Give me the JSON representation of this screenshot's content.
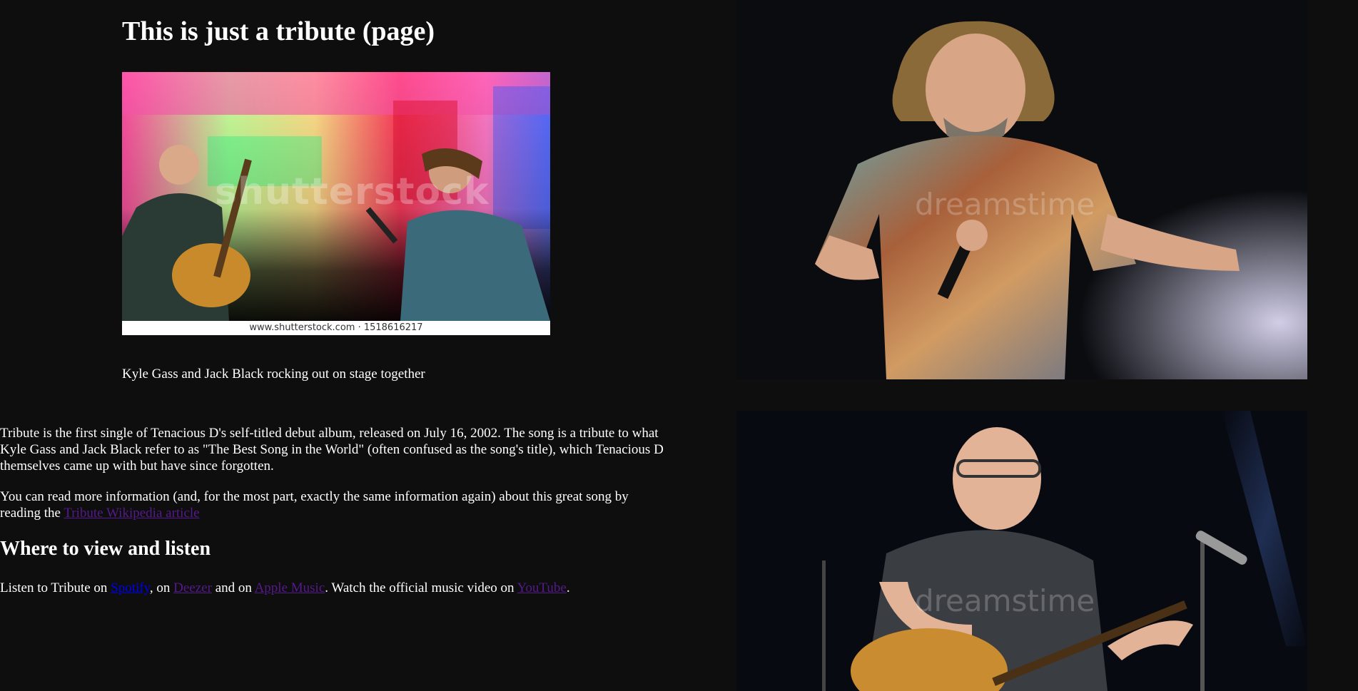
{
  "page": {
    "title": "This is just a tribute (page)"
  },
  "hero_image": {
    "alt": "Kyle Gass and Jack Black rocking out on stage together",
    "watermark": "shutterstock",
    "credit": "www.shutterstock.com · 1518616217"
  },
  "figure_caption": "Kyle Gass and Jack Black rocking out on stage together",
  "intro_paragraph": "Tribute is the first single of Tenacious D's self-titled debut album, released on July 16, 2002. The song is a tribute to what Kyle Gass and Jack Black refer to as \"The Best Song in the World\" (often confused as the song's title), which Tenacious D themselves came up with but have since forgotten.",
  "more_info": {
    "text_before": "You can read more information (and, for the most part, exactly the same information again) about this great song by reading the ",
    "link_label": "Tribute Wikipedia article"
  },
  "listen_section": {
    "heading": "Where to view and listen",
    "prefix": "Listen to Tribute on ",
    "spotify_label": "Spotify",
    "sep1": ", on ",
    "deezer_label": "Deezer",
    "sep2": " and on ",
    "apple_label": "Apple Music",
    "mid": ". Watch the official music video on ",
    "youtube_label": "YouTube",
    "suffix": "."
  },
  "side_photos": {
    "top_watermark": "dreamstime",
    "bottom_watermark": "dreamstime"
  },
  "colors": {
    "background": "#0e0e0e",
    "text": "#ffffff",
    "link_visited": "#551a8b",
    "link_unvisited": "#0000ee"
  }
}
